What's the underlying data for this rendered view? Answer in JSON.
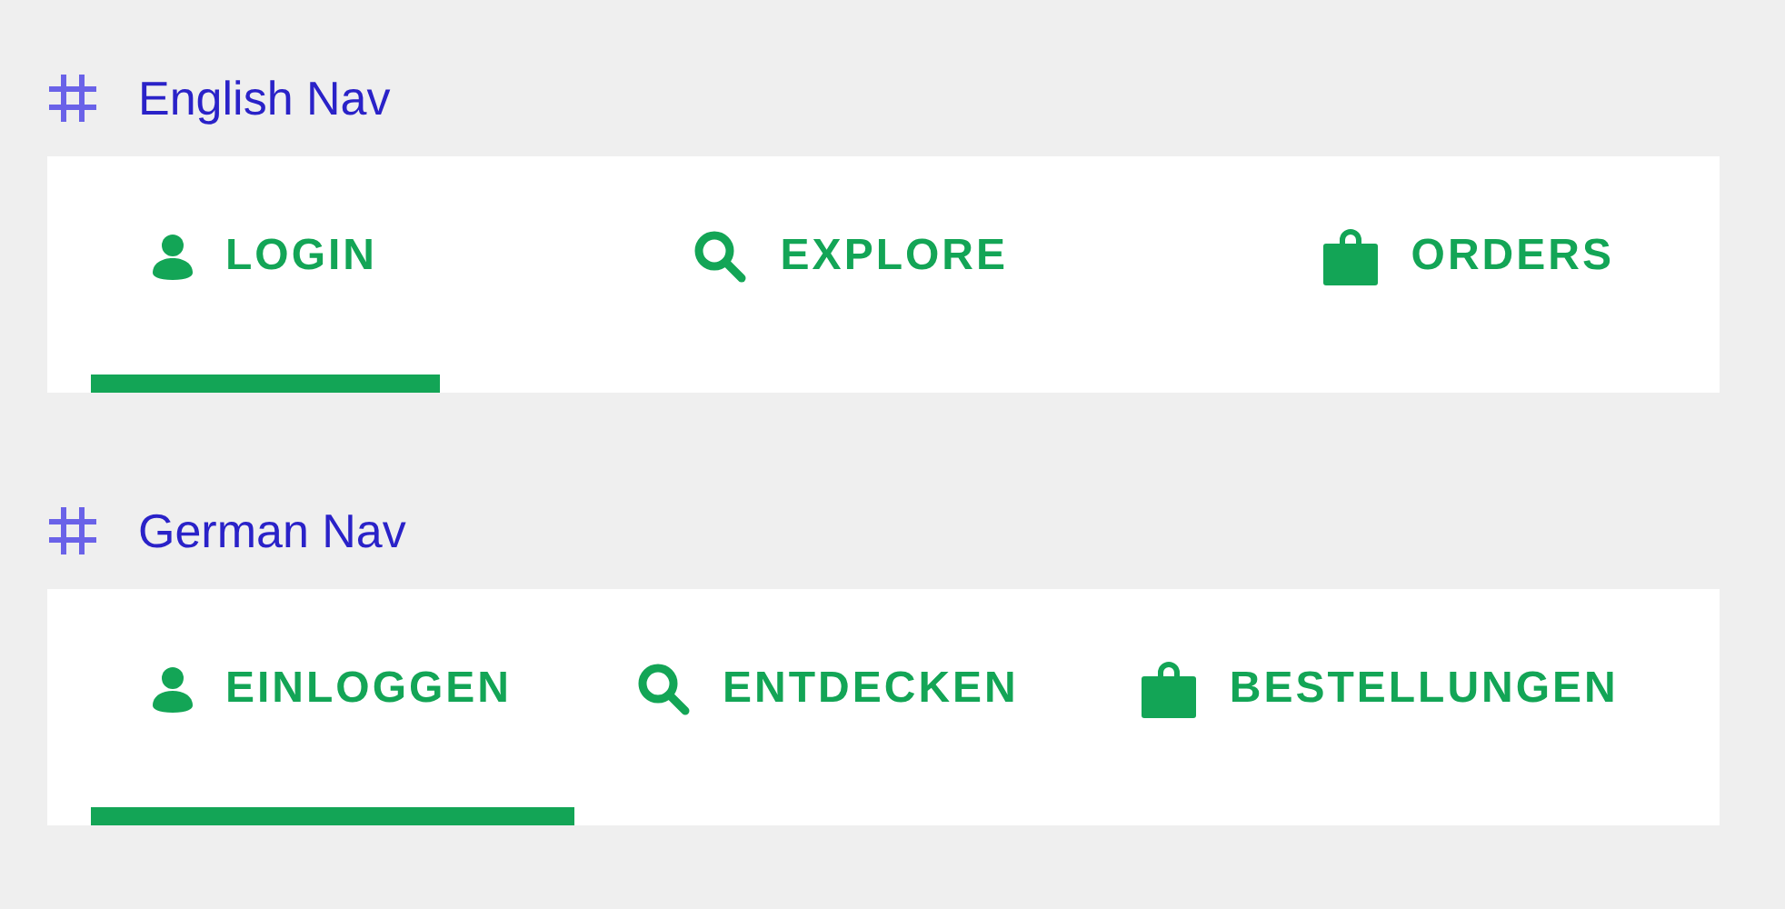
{
  "sections": [
    {
      "heading": "English Nav",
      "tabs": [
        {
          "label": "LOGIN",
          "selected": true
        },
        {
          "label": "EXPLORE",
          "selected": false
        },
        {
          "label": "ORDERS",
          "selected": false
        }
      ]
    },
    {
      "heading": "German Nav",
      "tabs": [
        {
          "label": "EINLOGGEN",
          "selected": true
        },
        {
          "label": "ENTDECKEN",
          "selected": false
        },
        {
          "label": "BESTELLUNGEN",
          "selected": false
        }
      ]
    }
  ]
}
